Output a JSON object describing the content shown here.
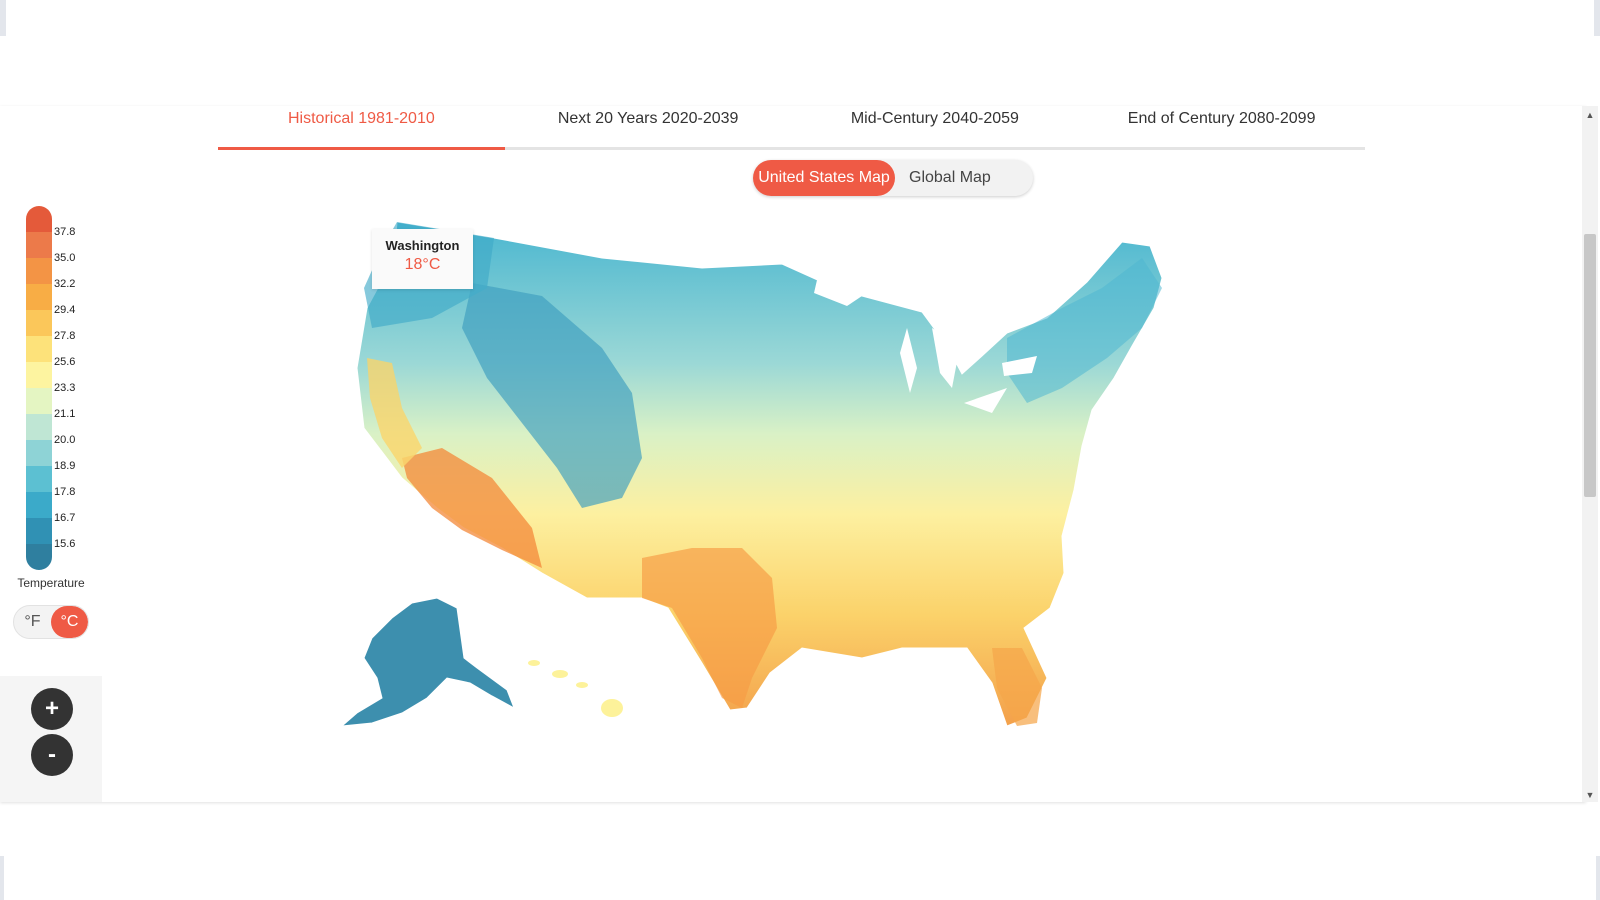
{
  "tabs": [
    {
      "label": "Historical 1981-2010",
      "active": true
    },
    {
      "label": "Next 20 Years 2020-2039",
      "active": false
    },
    {
      "label": "Mid-Century 2040-2059",
      "active": false
    },
    {
      "label": "End of Century 2080-2099",
      "active": false
    }
  ],
  "map_toggle": {
    "us_label": "United States Map",
    "global_label": "Global Map",
    "selected": "United States Map"
  },
  "tooltip": {
    "region": "Washington",
    "value": "18°C"
  },
  "legend": {
    "title": "Temperature",
    "labels": [
      "37.8",
      "35.0",
      "32.2",
      "29.4",
      "27.8",
      "25.6",
      "23.3",
      "21.1",
      "20.0",
      "18.9",
      "17.8",
      "16.7",
      "15.6"
    ],
    "colors": [
      "#e45a3a",
      "#ec7a4a",
      "#f39445",
      "#f8ad45",
      "#fbc75a",
      "#fde27a",
      "#fdf4a0",
      "#e4f5c2",
      "#bfe6d4",
      "#8ed3d6",
      "#5cc0d2",
      "#3baac9",
      "#3091b4",
      "#2f7f9f"
    ]
  },
  "units": {
    "f_label": "°F",
    "c_label": "°C",
    "selected": "°C"
  },
  "zoom": {
    "in_label": "+",
    "out_label": "-"
  },
  "colors": {
    "accent": "#ef5a45",
    "dark_button": "#333333"
  }
}
